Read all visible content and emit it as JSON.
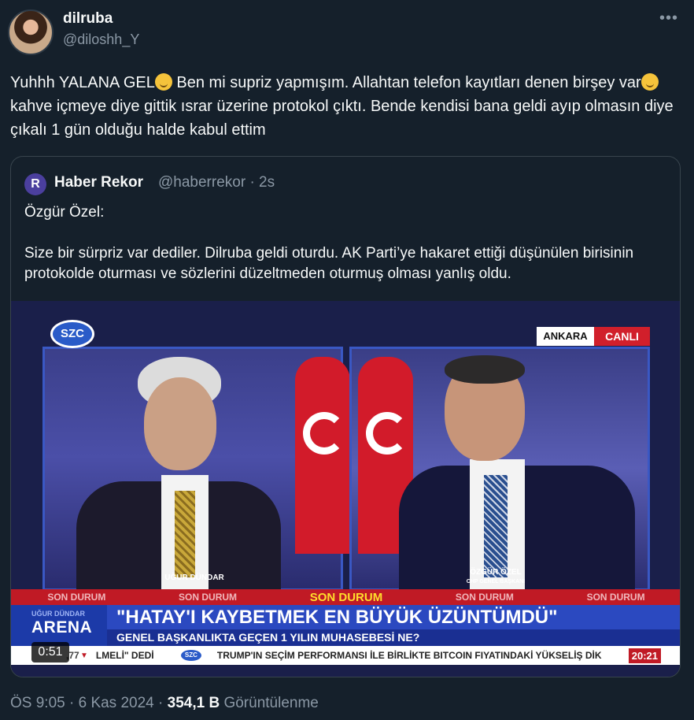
{
  "tweet": {
    "display_name": "dilruba",
    "handle": "@diloshh_Y",
    "more_icon": "more-dots-icon",
    "text_part1": "Yuhhh YALANA GEL",
    "text_part2": " Ben mi supriz yapmışım. Allahtan telefon kayıtları denen birşey var",
    "text_part3": " kahve içmeye diye gittik ısrar üzerine protokol çıktı. Bende kendisi bana geldi ayıp olmasın diye çıkalı 1 gün olduğu halde kabul ettim",
    "time": "ÖS 9:05 · 6 Kas 2024 · ",
    "views_count": "354,1 B",
    "views_label": " Görüntülenme"
  },
  "quote": {
    "avatar_letter": "R",
    "display_name": "Haber Rekor",
    "meta": "@haberrekor · 2s",
    "text_line1": "Özgür Özel:",
    "text_line2": "Size bir sürpriz var dediler. Dilruba geldi oturdu. AK Parti’ye hakaret ettiği düşünülen birisinin protokolde oturması ve sözlerini düzeltmeden oturmuş olması yanlış oldu."
  },
  "video": {
    "channel_logo": "SZC",
    "location": "ANKARA",
    "live": "CANLI",
    "left_name": "UĞUR DÜNDAR",
    "right_name": "ÖZGÜR ÖZEL",
    "right_title": "CHP GENEL BAŞKANI",
    "son_durum": [
      "SON DURUM",
      "SON DURUM",
      "SON DURUM",
      "SON DURUM",
      "SON DURUM",
      "SON DURUM"
    ],
    "arena_small": "UĞUR DÜNDAR",
    "arena_big": "ARENA",
    "headline": "\"HATAY'I KAYBETMEK EN BÜYÜK ÜZÜNTÜMDÜ\"",
    "subhead": "GENEL BAŞKANLIKTA GEÇEN 1 YILIN MUHASEBESİ NE?",
    "ticker_1": ",77",
    "ticker_2": "LMELİ\" DEDİ",
    "ticker_logo": "SZC",
    "ticker_3": "TRUMP'IN SEÇİM PERFORMANSI İLE BİRLİKTE BITCOIN FIYATINDAKİ YÜKSELİŞ DİK",
    "ticker_time": "20:21",
    "duration": "0:51"
  }
}
